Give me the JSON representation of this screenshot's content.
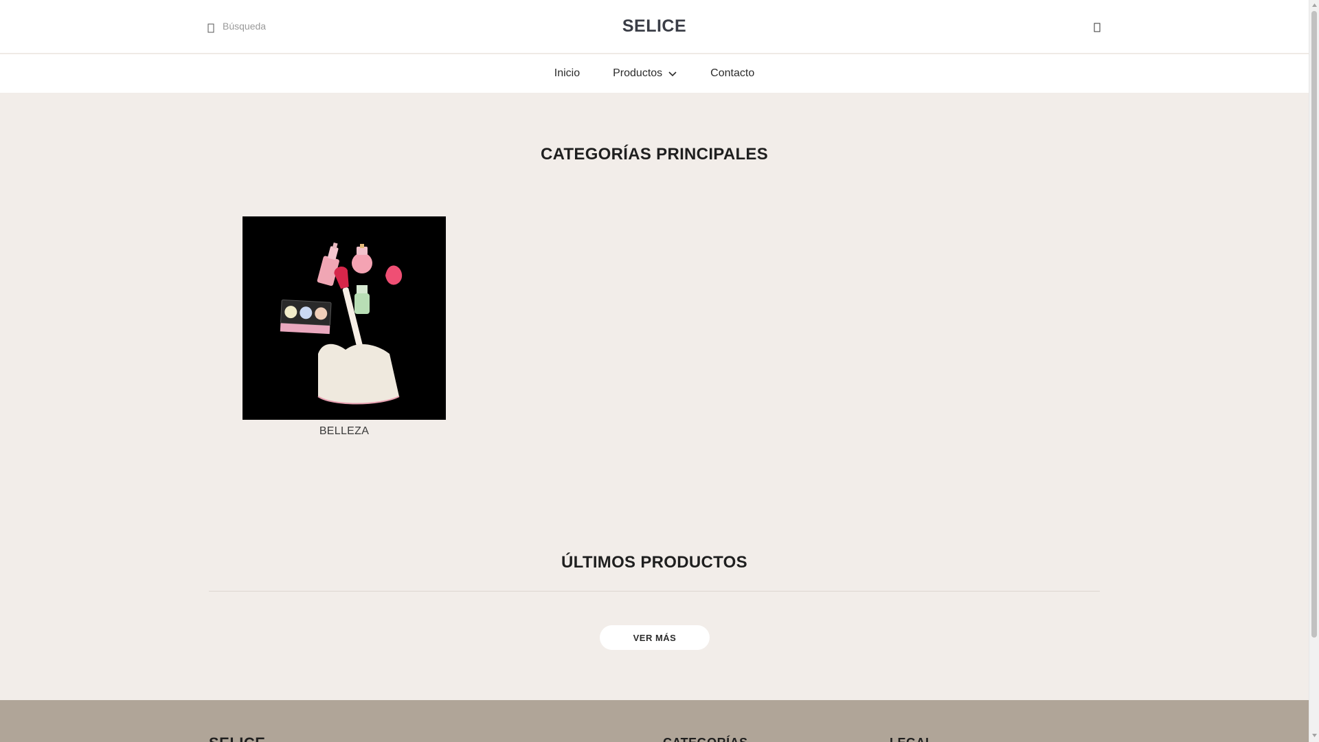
{
  "header": {
    "search_placeholder": "Búsqueda",
    "brand": "SELICE"
  },
  "nav": {
    "items": [
      {
        "label": "Inicio",
        "icon": null
      },
      {
        "label": "Productos",
        "icon": "chevron-down-icon"
      },
      {
        "label": "Contacto",
        "icon": null
      }
    ]
  },
  "categories": {
    "title": "CATEGORÍAS PRINCIPALES",
    "items": [
      {
        "label": "BELLEZA",
        "image": "makeup-products-photo"
      }
    ]
  },
  "latest": {
    "title": "ÚLTIMOS PRODUCTOS",
    "more_label": "VER MÁS"
  },
  "footer": {
    "brand": "SELICE",
    "categories_heading": "CATEGORÍAS",
    "legal_heading": "LEGAL"
  },
  "colors": {
    "background": "#f2ede9",
    "header_bg": "#ffffff",
    "footer_bg": "#b0a598",
    "text": "#2b2b2b",
    "brand": "#3a3d46"
  }
}
